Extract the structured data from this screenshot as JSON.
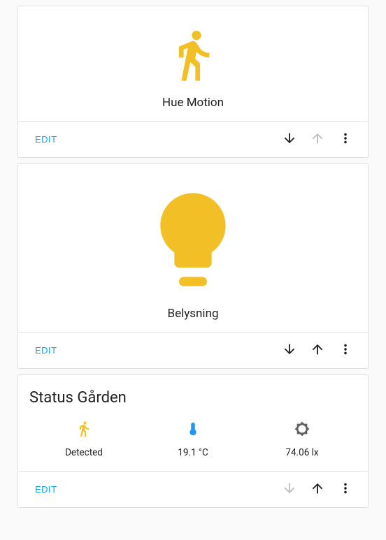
{
  "colors": {
    "accent": "#f2c026",
    "link": "#03a9f4"
  },
  "cards": [
    {
      "label": "Hue Motion",
      "edit": "EDIT",
      "down_enabled": true,
      "up_enabled": false
    },
    {
      "label": "Belysning",
      "edit": "EDIT",
      "down_enabled": true,
      "up_enabled": true
    }
  ],
  "status_card": {
    "title": "Status Gården",
    "edit": "EDIT",
    "items": [
      {
        "value": "Detected"
      },
      {
        "value": "19.1 °C"
      },
      {
        "value": "74.06 lx"
      }
    ],
    "down_enabled": false,
    "up_enabled": true
  }
}
